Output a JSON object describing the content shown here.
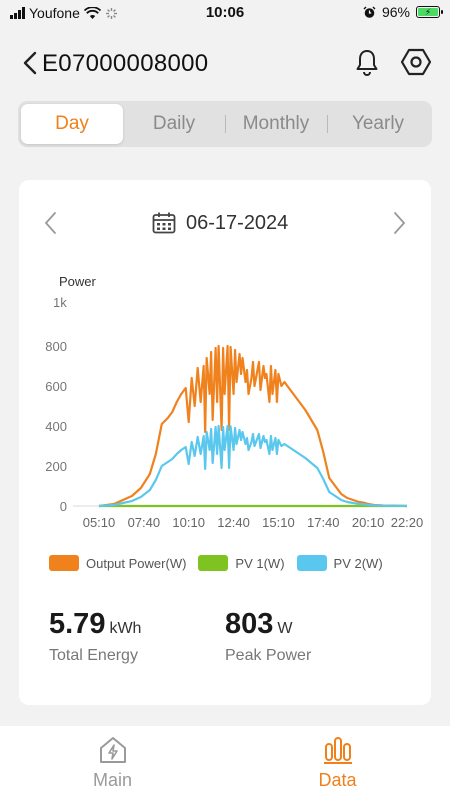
{
  "status_bar": {
    "carrier": "Youfone",
    "time": "10:06",
    "battery_percent": "96%",
    "battery_level": 0.96,
    "icons": [
      "signal-icon",
      "wifi-icon",
      "activity-icon",
      "alarm-icon",
      "battery-charging-icon"
    ]
  },
  "header": {
    "title": "E07000008000",
    "icons": [
      "back-icon",
      "bell-icon",
      "settings-icon"
    ]
  },
  "tabs": {
    "items": [
      "Day",
      "Daily",
      "Monthly",
      "Yearly"
    ],
    "selected": "Day"
  },
  "date_picker": {
    "date": "06-17-2024",
    "icons": [
      "chevron-left-icon",
      "calendar-icon",
      "chevron-right-icon"
    ]
  },
  "chart_data": {
    "type": "line",
    "ylabel": "Power",
    "y_unit_label": "1k",
    "ylim": [
      0,
      1000
    ],
    "yticks": [
      0,
      200,
      400,
      600,
      800
    ],
    "xlim": [
      "05:10",
      "22:20"
    ],
    "xticks": [
      "05:10",
      "07:40",
      "10:10",
      "12:40",
      "15:10",
      "17:40",
      "20:10",
      "22:20"
    ],
    "grid": false,
    "legend_position": "bottom",
    "series": [
      {
        "name": "Output Power(W)",
        "color": "#f0821e",
        "x": [
          "05:10",
          "06:00",
          "06:30",
          "07:00",
          "07:30",
          "08:00",
          "08:20",
          "08:40",
          "09:00",
          "09:15",
          "09:30",
          "09:45",
          "10:00",
          "10:10",
          "10:20",
          "10:30",
          "10:40",
          "10:50",
          "11:00",
          "11:05",
          "11:10",
          "11:20",
          "11:25",
          "11:30",
          "11:40",
          "11:45",
          "11:50",
          "12:00",
          "12:05",
          "12:10",
          "12:20",
          "12:25",
          "12:30",
          "12:40",
          "12:45",
          "12:50",
          "13:00",
          "13:05",
          "13:10",
          "13:20",
          "13:25",
          "13:30",
          "13:40",
          "13:45",
          "13:50",
          "14:00",
          "14:05",
          "14:10",
          "14:20",
          "14:25",
          "14:30",
          "14:40",
          "14:45",
          "14:50",
          "15:00",
          "15:05",
          "15:10",
          "15:20",
          "15:30",
          "15:45",
          "16:00",
          "16:20",
          "16:40",
          "17:00",
          "17:20",
          "17:40",
          "18:00",
          "18:20",
          "18:40",
          "19:00",
          "19:20",
          "19:40",
          "20:00",
          "20:10",
          "20:30",
          "21:00",
          "21:30",
          "22:00",
          "22:20"
        ],
        "values": [
          0,
          10,
          30,
          50,
          90,
          160,
          260,
          410,
          440,
          470,
          520,
          560,
          590,
          420,
          640,
          500,
          690,
          520,
          700,
          370,
          740,
          560,
          770,
          430,
          790,
          520,
          800,
          380,
          790,
          560,
          800,
          380,
          795,
          560,
          780,
          620,
          760,
          660,
          740,
          620,
          680,
          560,
          640,
          720,
          600,
          680,
          720,
          580,
          700,
          640,
          660,
          520,
          700,
          560,
          680,
          520,
          660,
          600,
          620,
          590,
          560,
          520,
          480,
          430,
          380,
          270,
          140,
          100,
          60,
          40,
          30,
          20,
          15,
          10,
          5,
          3,
          2,
          1,
          0
        ]
      },
      {
        "name": "PV 1(W)",
        "color": "#7ec31f",
        "x": [
          "05:10",
          "22:20"
        ],
        "values": [
          0,
          0
        ]
      },
      {
        "name": "PV 2(W)",
        "color": "#5ac8ee",
        "x": [
          "05:10",
          "06:00",
          "06:30",
          "07:00",
          "07:30",
          "08:00",
          "08:20",
          "08:40",
          "09:00",
          "09:15",
          "09:30",
          "09:45",
          "10:00",
          "10:10",
          "10:20",
          "10:30",
          "10:40",
          "10:50",
          "11:00",
          "11:05",
          "11:10",
          "11:20",
          "11:25",
          "11:30",
          "11:40",
          "11:45",
          "11:50",
          "12:00",
          "12:05",
          "12:10",
          "12:20",
          "12:25",
          "12:30",
          "12:40",
          "12:45",
          "12:50",
          "13:00",
          "13:05",
          "13:10",
          "13:20",
          "13:25",
          "13:30",
          "13:40",
          "13:45",
          "13:50",
          "14:00",
          "14:05",
          "14:10",
          "14:20",
          "14:25",
          "14:30",
          "14:40",
          "14:45",
          "14:50",
          "15:00",
          "15:05",
          "15:10",
          "15:20",
          "15:30",
          "15:45",
          "16:00",
          "16:20",
          "16:40",
          "17:00",
          "17:20",
          "17:40",
          "18:00",
          "18:20",
          "18:40",
          "19:00",
          "19:20",
          "19:40",
          "20:00",
          "20:10",
          "20:30",
          "21:00",
          "21:30",
          "22:00",
          "22:20"
        ],
        "values": [
          0,
          5,
          15,
          25,
          45,
          80,
          130,
          200,
          220,
          235,
          260,
          280,
          295,
          210,
          320,
          250,
          345,
          260,
          350,
          185,
          370,
          280,
          385,
          215,
          395,
          260,
          400,
          190,
          395,
          280,
          400,
          190,
          398,
          280,
          390,
          310,
          380,
          330,
          370,
          310,
          340,
          280,
          320,
          360,
          300,
          340,
          360,
          290,
          350,
          320,
          330,
          260,
          350,
          280,
          340,
          260,
          330,
          300,
          310,
          295,
          280,
          260,
          240,
          215,
          190,
          135,
          70,
          50,
          30,
          20,
          15,
          10,
          8,
          5,
          3,
          2,
          1,
          1,
          0
        ]
      }
    ]
  },
  "stats": {
    "total_energy_value": "5.79",
    "total_energy_unit": "kWh",
    "total_energy_label": "Total Energy",
    "peak_power_value": "803",
    "peak_power_unit": "W",
    "peak_power_label": "Peak Power"
  },
  "tabbar": {
    "main_label": "Main",
    "data_label": "Data",
    "active": "Data",
    "icons": [
      "home-bolt-icon",
      "bar-chart-icon"
    ],
    "accent_color": "#f0801a",
    "inactive_color": "#9a9a9a"
  }
}
